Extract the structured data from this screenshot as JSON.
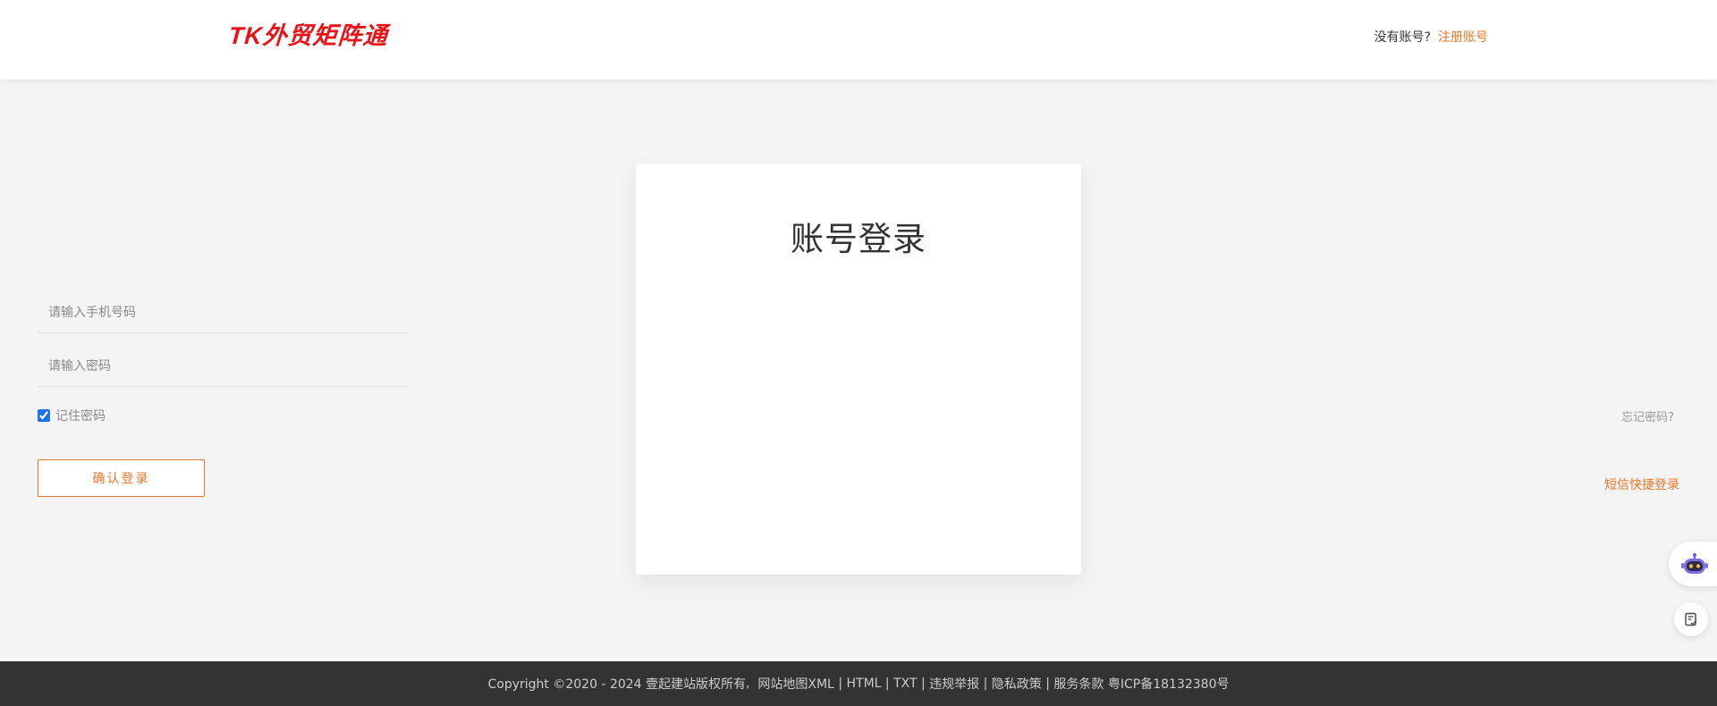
{
  "header": {
    "logo_text": "TK外贸矩阵通",
    "no_account_text": "没有账号?",
    "register_link": "注册账号"
  },
  "login": {
    "title": "账号登录",
    "phone_placeholder": "请输入手机号码",
    "password_placeholder": "请输入密码",
    "remember_label": "记住密码",
    "remember_checked": true,
    "forgot_link": "忘记密码?",
    "submit_label": "确认登录",
    "sms_link": "短信快捷登录"
  },
  "footer": {
    "copyright": "Copyright ©2020 - 2024 壹起建站版权所有",
    "sep_comma": ",",
    "links": [
      "网站地图XML",
      "HTML",
      "TXT",
      "违规举报",
      "隐私政策",
      "服务条款"
    ],
    "icp": "粤ICP备18132380号"
  },
  "floating": {
    "robot_icon": "robot-icon",
    "note_icon": "notepad-icon"
  },
  "colors": {
    "brand_red": "#e8131a",
    "accent_orange": "#e8782c",
    "footer_bg": "#333333",
    "page_bg": "#f4f4f4"
  }
}
